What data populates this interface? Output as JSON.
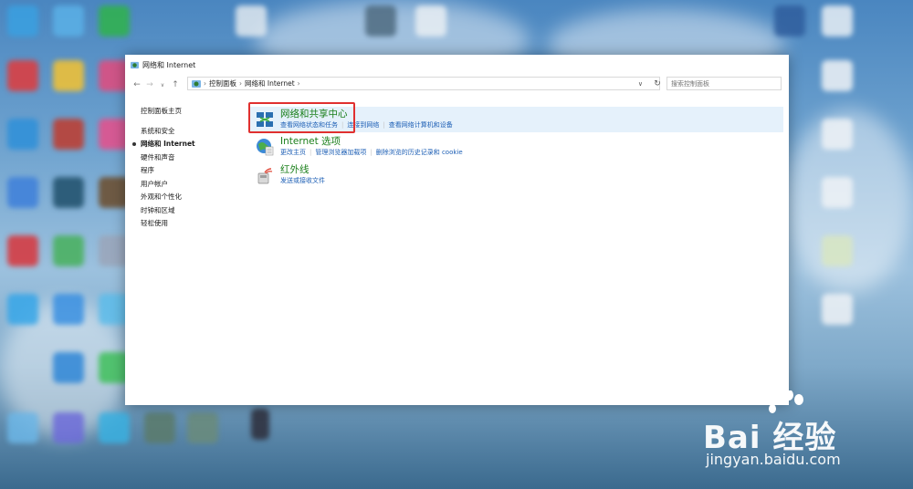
{
  "window": {
    "title": "网络和 Internet"
  },
  "address_bar": {
    "crumbs": [
      "控制面板",
      "网络和 Internet"
    ],
    "search_placeholder": "搜索控制面板"
  },
  "sidebar": {
    "home": "控制面板主页",
    "items": [
      {
        "label": "系统和安全"
      },
      {
        "label": "网络和 Internet"
      },
      {
        "label": "硬件和声音"
      },
      {
        "label": "程序"
      },
      {
        "label": "用户帐户"
      },
      {
        "label": "外观和个性化"
      },
      {
        "label": "时钟和区域"
      },
      {
        "label": "轻松使用"
      }
    ]
  },
  "categories": [
    {
      "title": "网络和共享中心",
      "icon": "network-sharing-icon",
      "links": [
        "查看网络状态和任务",
        "连接到网络",
        "查看网络计算机和设备"
      ]
    },
    {
      "title": "Internet 选项",
      "icon": "internet-options-icon",
      "links": [
        "更改主页",
        "管理浏览器加载项",
        "删除浏览的历史记录和 cookie"
      ]
    },
    {
      "title": "红外线",
      "icon": "infrared-icon",
      "links": [
        "发送或接收文件"
      ]
    }
  ],
  "watermark": {
    "brand": "Bai 经验",
    "url": "jingyan.baidu.com"
  },
  "colors": {
    "category_title": "#1a7f1a",
    "link": "#1d5fb5",
    "highlight_box": "#e0302f",
    "hover_row": "#e5f1fb"
  }
}
